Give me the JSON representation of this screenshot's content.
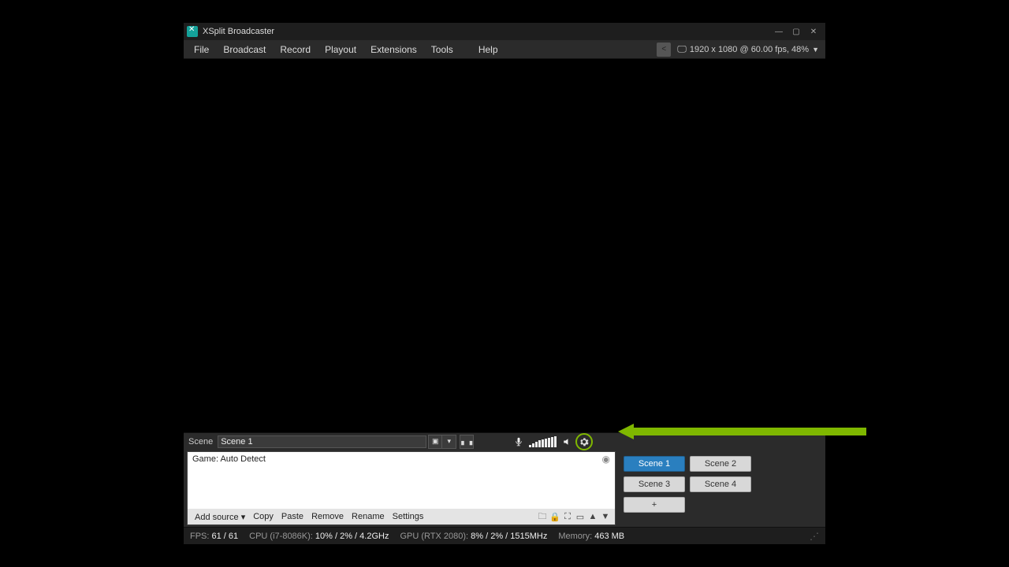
{
  "title": "XSplit Broadcaster",
  "menus": [
    "File",
    "Broadcast",
    "Record",
    "Playout",
    "Extensions",
    "Tools",
    "Help"
  ],
  "resolution_info": "1920 x 1080 @ 60.00 fps, 48%",
  "scene_toolbar": {
    "label": "Scene",
    "name_value": "Scene 1"
  },
  "sources": {
    "items": [
      "Game: Auto Detect"
    ],
    "toolbar": {
      "add_source": "Add source",
      "copy": "Copy",
      "paste": "Paste",
      "remove": "Remove",
      "rename": "Rename",
      "settings": "Settings"
    }
  },
  "scenes": [
    {
      "label": "Scene 1",
      "active": true
    },
    {
      "label": "Scene 2",
      "active": false
    },
    {
      "label": "Scene 3",
      "active": false
    },
    {
      "label": "Scene 4",
      "active": false
    },
    {
      "label": "+",
      "active": false
    }
  ],
  "status": {
    "fps_label": "FPS:",
    "fps_value": "61 / 61",
    "cpu_label": "CPU (i7-8086K):",
    "cpu_value": "10% / 2% / 4.2GHz",
    "gpu_label": "GPU (RTX 2080):",
    "gpu_value": "8% / 2% / 1515MHz",
    "mem_label": "Memory:",
    "mem_value": "463 MB"
  }
}
